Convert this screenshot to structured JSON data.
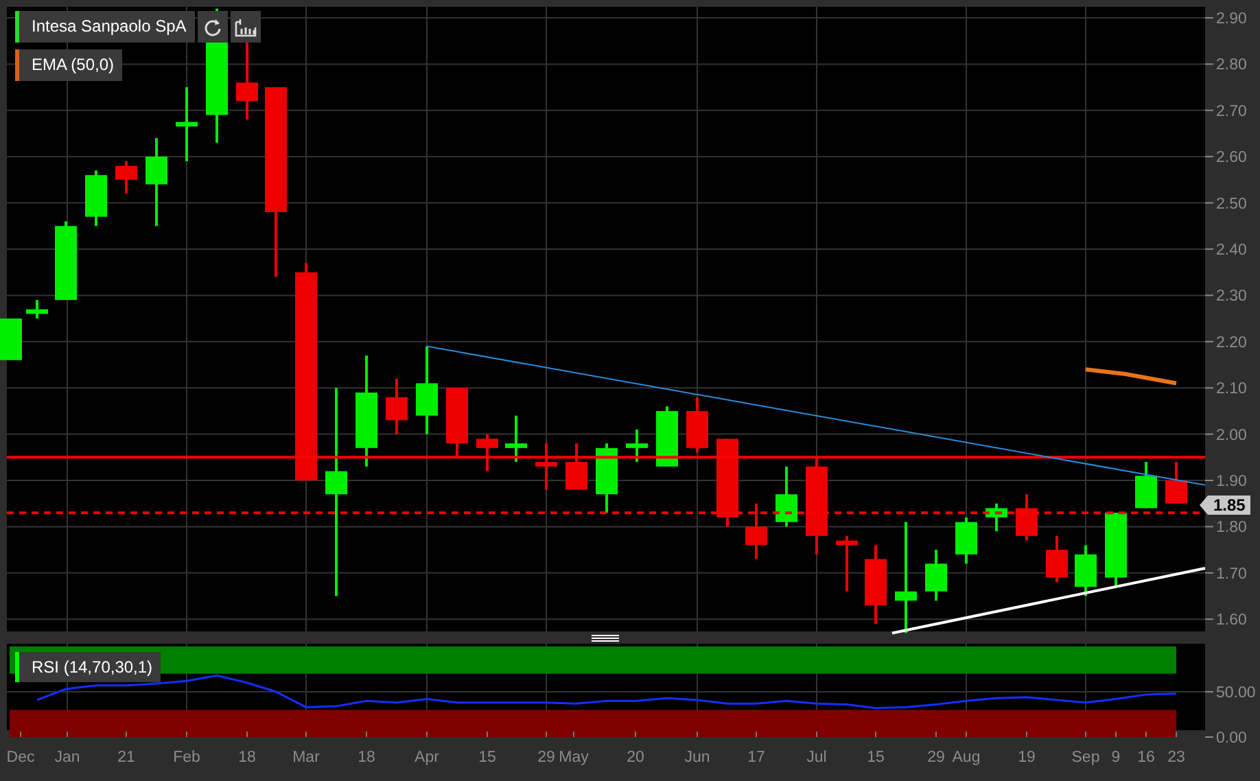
{
  "instrument": {
    "name": "Intesa Sanpaolo SpA"
  },
  "overlays": [
    {
      "name": "EMA (50,0)"
    }
  ],
  "price_axis": {
    "ticks": [
      "2.90",
      "2.80",
      "2.70",
      "2.60",
      "2.50",
      "2.40",
      "2.30",
      "2.20",
      "2.10",
      "2.00",
      "1.90",
      "1.80",
      "1.70",
      "1.60"
    ],
    "last_price": "1.85"
  },
  "rsi": {
    "name": "RSI (14,70,30,1)",
    "ticks": [
      "50.00",
      "0.00"
    ]
  },
  "time_axis": [
    "Dec",
    "Jan",
    "21",
    "Feb",
    "18",
    "Mar",
    "18",
    "Apr",
    "15",
    "29",
    "May",
    "20",
    "Jun",
    "17",
    "Jul",
    "15",
    "29",
    "Aug",
    "19",
    "Sep",
    "9",
    "16",
    "23"
  ]
}
